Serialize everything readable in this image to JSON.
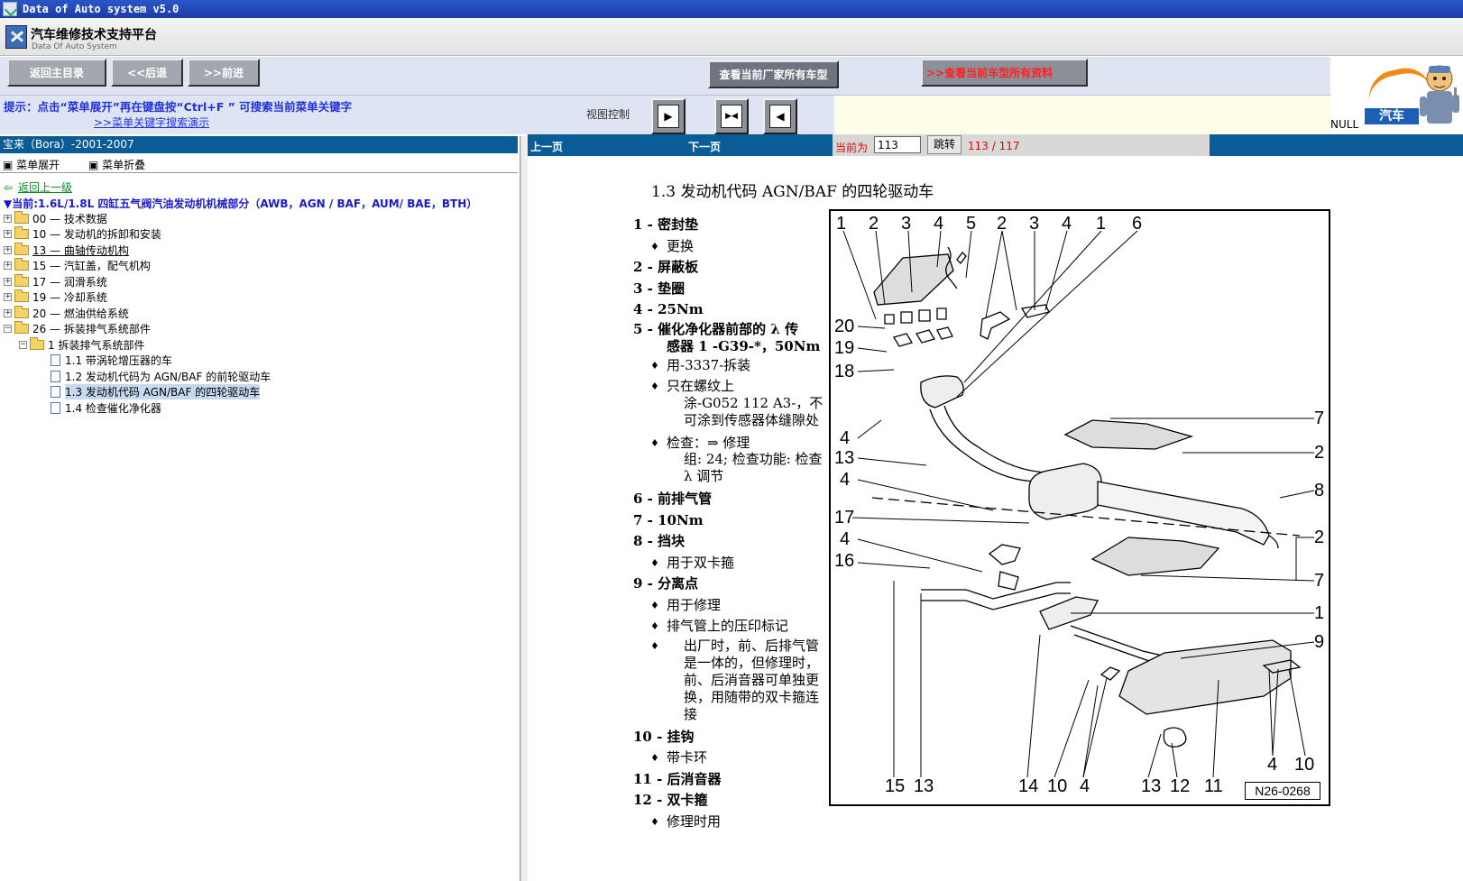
{
  "window": {
    "title": "Data of Auto system v5.0"
  },
  "brand": {
    "title": "汽车维修技术支持平台",
    "subtitle": "Data Of Auto System"
  },
  "toolbar": {
    "home_label": "返回主目录",
    "back_label": "<<后退",
    "forward_label": ">>前进",
    "all_models_label": "查看当前厂家所有车型",
    "all_docs_label": ">>查看当前车型所有资料"
  },
  "ad": {
    "null_text": "NULL",
    "car_text": "汽车"
  },
  "hint": {
    "text": "提示：点击“菜单展开”再在键盘按“Ctrl+F ” 可搜索当前菜单关键字",
    "link": ">>菜单关键字搜索演示"
  },
  "view_control": {
    "label": "视图控制",
    "btn1": "▶",
    "btn2": "▶◀",
    "btn3": "◀"
  },
  "left": {
    "header": "宝来（Bora）-2001-2007",
    "expand": "菜单展开",
    "collapse": "菜单折叠",
    "back_up": "返回上一级",
    "current": "当前:1.6L/1.8L 四缸五气阀汽油发动机机械部分（AWB，AGN / BAF，AUM/ BAE，BTH）",
    "tree": [
      {
        "label": "00 — 技术数据"
      },
      {
        "label": "10 — 发动机的拆卸和安装"
      },
      {
        "label": "13 — 曲轴传动机构"
      },
      {
        "label": "15 — 汽缸盖，配气机构"
      },
      {
        "label": "17 — 润滑系统"
      },
      {
        "label": "19 — 冷却系统"
      },
      {
        "label": "20 — 燃油供给系统"
      },
      {
        "label": "26 — 拆装排气系统部件"
      },
      {
        "label": "1 拆装排气系统部件"
      },
      {
        "label": "1.1 带涡轮增压器的车"
      },
      {
        "label": "1.2 发动机代码为 AGN/BAF 的前轮驱动车"
      },
      {
        "label": "1.3 发动机代码 AGN/BAF 的四轮驱动车"
      },
      {
        "label": "1.4 检查催化净化器"
      }
    ]
  },
  "nav": {
    "prev": "上一页",
    "next": "下一页",
    "current_label": "当前为",
    "page_value": "113",
    "go_label": "跳转",
    "pages": "113 / 117"
  },
  "doc": {
    "title": "1.3   发动机代码 AGN/BAF 的四轮驱动车",
    "legend": {
      "i1": "1 - 密封垫",
      "i1a": "更换",
      "i2": "2 - 屏蔽板",
      "i3": "3 - 垫圈",
      "i4": "4 - 25Nm",
      "i5": "5 - 催化净化器前部的 λ 传",
      "i5b": "感器 1 -G39-*，50Nm",
      "i5a": "用-3337-拆装",
      "i5c": "只在螺纹上",
      "i5d": "涂-G052 112 A3-，不可涂到传感器体缝隙处",
      "i5e": "检查：⇒ 修理",
      "i5f": "组: 24; 检查功能: 检查 λ 调节",
      "i6": "6 - 前排气管",
      "i7": "7 - 10Nm",
      "i8": "8 - 挡块",
      "i8a": "用于双卡箍",
      "i9": "9 - 分离点",
      "i9a": "用于修理",
      "i9b": "排气管上的压印标记",
      "i9c": "出厂时，前、后排气管是一体的，但修理时，前、后消音器可单独更换，用随带的双卡箍连接",
      "i10": "10 - 挂钩",
      "i10a": "带卡环",
      "i11": "11 - 后消音器",
      "i12": "12 - 双卡箍",
      "i12a": "修理时用"
    },
    "figure_id": "N26-0268",
    "callouts": {
      "t1": "1",
      "t2": "2",
      "t3": "3",
      "t4": "4",
      "t5": "5",
      "t6": "2",
      "t7": "3",
      "t8": "4",
      "t9": "1",
      "t10": "6",
      "l20": "20",
      "l19": "19",
      "l18": "18",
      "l4a": "4",
      "l13": "13",
      "l4b": "4",
      "l17": "17",
      "l4c": "4",
      "l16": "16",
      "r7a": "7",
      "r2a": "2",
      "r8": "8",
      "r2b": "2",
      "r7b": "7",
      "r1": "1",
      "r9": "9",
      "b15": "15",
      "b13": "13",
      "b14": "14",
      "b10": "10",
      "b4": "4",
      "b13b": "13",
      "b12": "12",
      "b11": "11",
      "b4b": "4",
      "b10b": "10"
    }
  }
}
